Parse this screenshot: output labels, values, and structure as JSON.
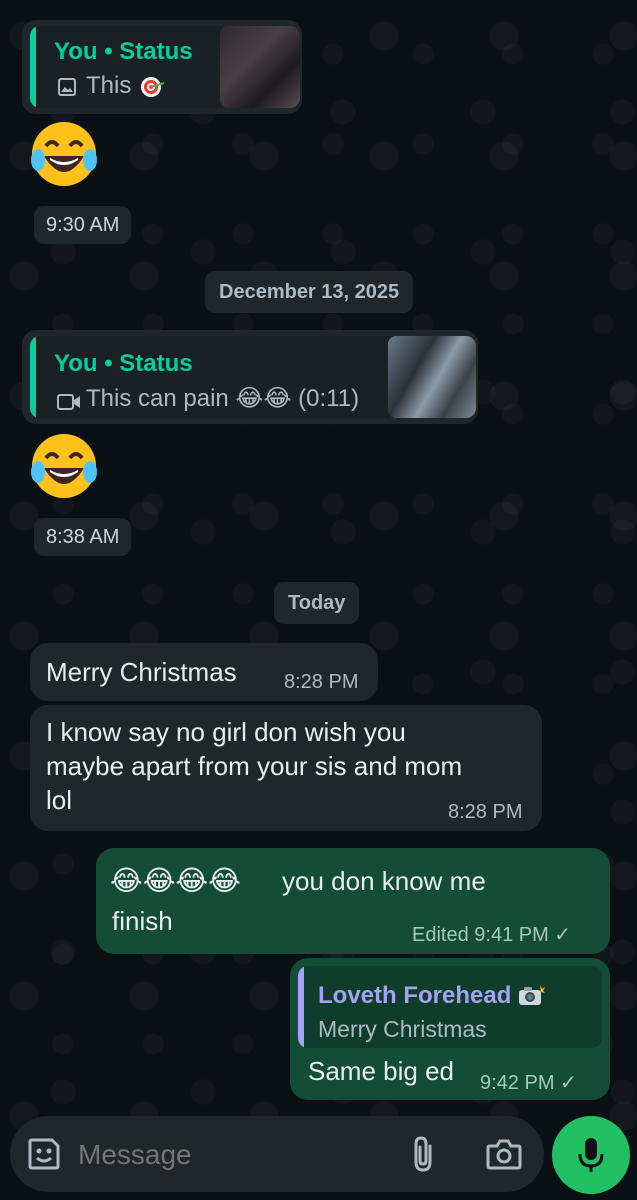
{
  "messages": {
    "m1": {
      "quote_title": "You • Status",
      "quote_sub": "This",
      "quote_emoji_icon": "target-icon",
      "reply_emoji": "face-with-tears-of-joy",
      "time": "9:30 AM"
    },
    "date1": "December 13, 2025",
    "m2": {
      "quote_title": "You • Status",
      "quote_sub": "This can pain 😂😂 (0:11)",
      "media_icon": "video-camera-icon",
      "reply_emoji": "face-with-tears-of-joy",
      "time": "8:38 AM"
    },
    "date2": "Today",
    "m3": {
      "text": "Merry Christmas",
      "time": "8:28 PM"
    },
    "m4": {
      "line1": "I know say no girl  don wish you",
      "line2": "maybe apart from your sis and mom",
      "line3": "lol",
      "time": "8:28 PM"
    },
    "m5": {
      "emojis": "😂😂😂😂",
      "line1": " you don know me",
      "line2": "finish",
      "status": "Edited 9:41 PM ✓"
    },
    "m6": {
      "quote_title": "Loveth Forehead",
      "quote_icon": "camera-flash-icon",
      "quote_sub": "Merry Christmas",
      "text": "Same big ed",
      "time": "9:42 PM ✓"
    }
  },
  "composer": {
    "placeholder": "Message",
    "sticker_icon": "sticker-icon",
    "attach_icon": "paperclip-icon",
    "camera_icon": "camera-icon",
    "mic_icon": "microphone-icon"
  },
  "colors": {
    "background": "#0b1014",
    "incoming": "#1f272a",
    "outgoing": "#144d37",
    "accent_green": "#21c063",
    "quote_name_green": "#06cf9c",
    "quote_name_purple": "#a5a2f3"
  }
}
